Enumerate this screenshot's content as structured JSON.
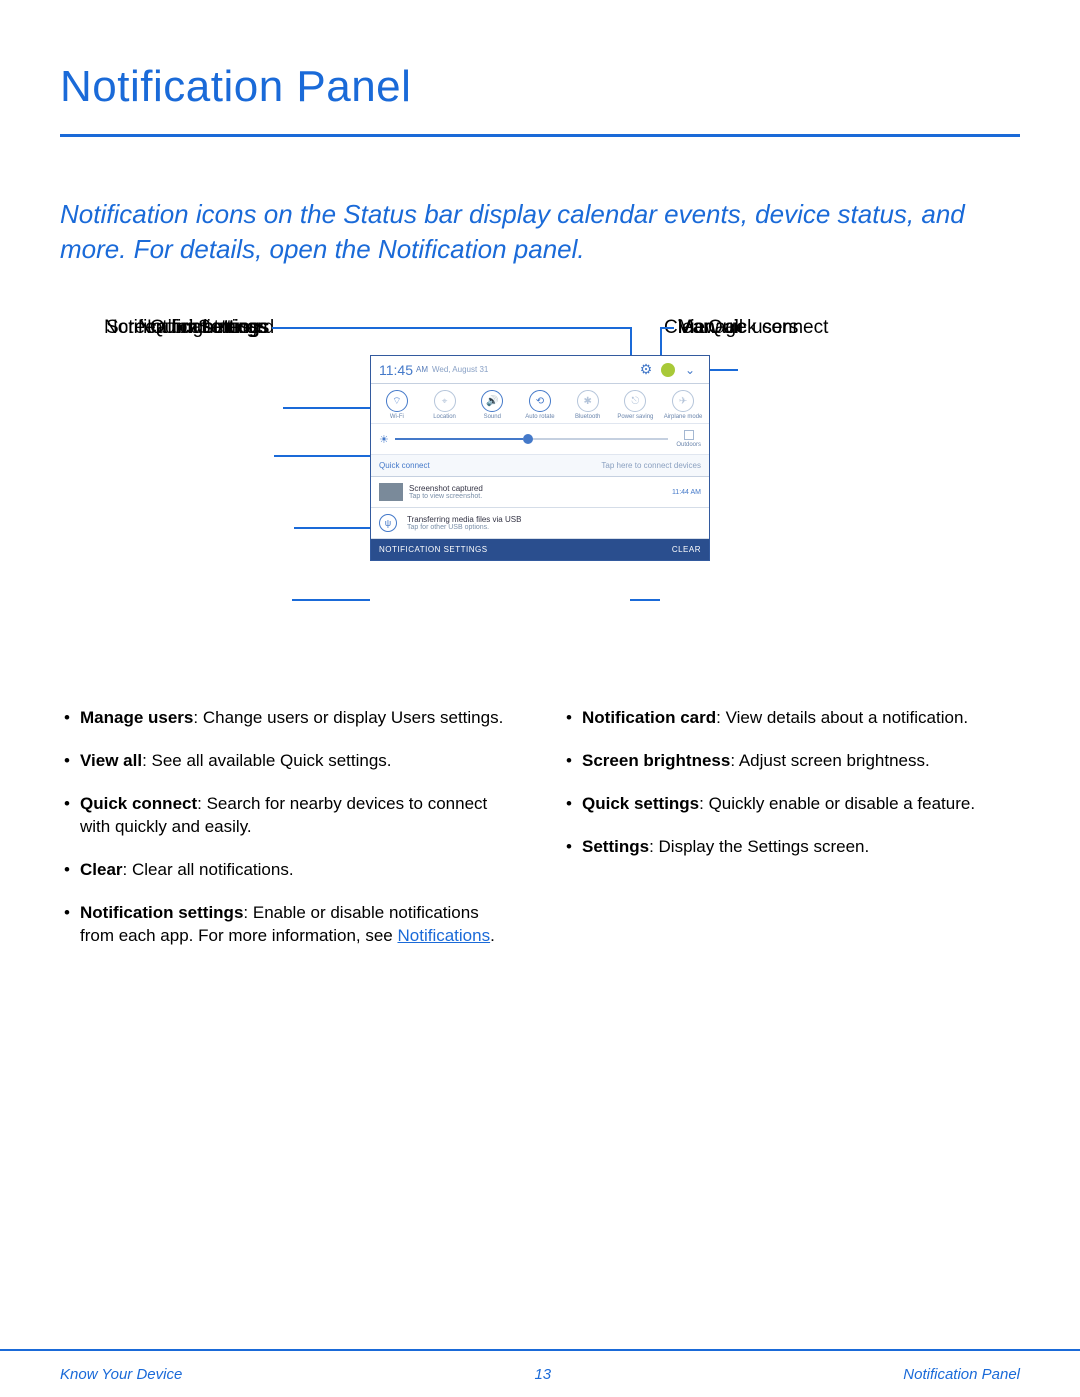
{
  "title": "Notification Panel",
  "intro": "Notification icons on the Status bar display calendar events, device status, and more. For details, open the Notification panel.",
  "labels": {
    "settings": "Settings",
    "quick_settings": "Quick settings",
    "screen_brightness": "Screen brightness",
    "notification_card": "Notification card",
    "notification_settings": "Notification settings",
    "manage_users": "Manage users",
    "view_all": "View all",
    "quick_connect": "Quick connect",
    "clear": "Clear"
  },
  "panel": {
    "time": "11:45",
    "ampm": "AM",
    "date": "Wed, August 31",
    "qs": [
      {
        "label": "Wi-Fi",
        "glyph": "⌔",
        "on": true
      },
      {
        "label": "Location",
        "glyph": "⌖",
        "on": false
      },
      {
        "label": "Sound",
        "glyph": "🔊",
        "on": true
      },
      {
        "label": "Auto rotate",
        "glyph": "⟲",
        "on": true
      },
      {
        "label": "Bluetooth",
        "glyph": "✱",
        "on": false
      },
      {
        "label": "Power saving",
        "glyph": "⎋",
        "on": false
      },
      {
        "label": "Airplane mode",
        "glyph": "✈",
        "on": false
      }
    ],
    "outdoors": "Outdoors",
    "qc_label": "Quick connect",
    "qc_hint": "Tap here to connect devices",
    "card1": {
      "t1": "Screenshot captured",
      "t2": "Tap to view screenshot.",
      "ts": "11:44 AM"
    },
    "card2": {
      "t1": "Transferring media files via USB",
      "t2": "Tap for other USB options."
    },
    "foot_left": "NOTIFICATION SETTINGS",
    "foot_right": "CLEAR"
  },
  "bullets_left": [
    {
      "term": "Manage users",
      "desc": ": Change users or display Users settings."
    },
    {
      "term": "View all",
      "desc": ": See all available Quick settings."
    },
    {
      "term": "Quick connect",
      "desc": ": Search for nearby devices to connect with quickly and easily."
    },
    {
      "term": "Clear",
      "desc": ": Clear all notifications."
    },
    {
      "term": "Notification settings",
      "desc": ": Enable or disable notifications from each app. For more information, see ",
      "link": "Notifications",
      "tail": "."
    }
  ],
  "bullets_right": [
    {
      "term": "Notification card",
      "desc": ": View details about a notification."
    },
    {
      "term": "Screen brightness",
      "desc": ": Adjust screen brightness."
    },
    {
      "term": "Quick settings",
      "desc": ": Quickly enable or disable a feature."
    },
    {
      "term": "Settings",
      "desc": ": Display the Settings screen."
    }
  ],
  "footer": {
    "left": "Know Your Device",
    "page": "13",
    "right": "Notification Panel"
  }
}
